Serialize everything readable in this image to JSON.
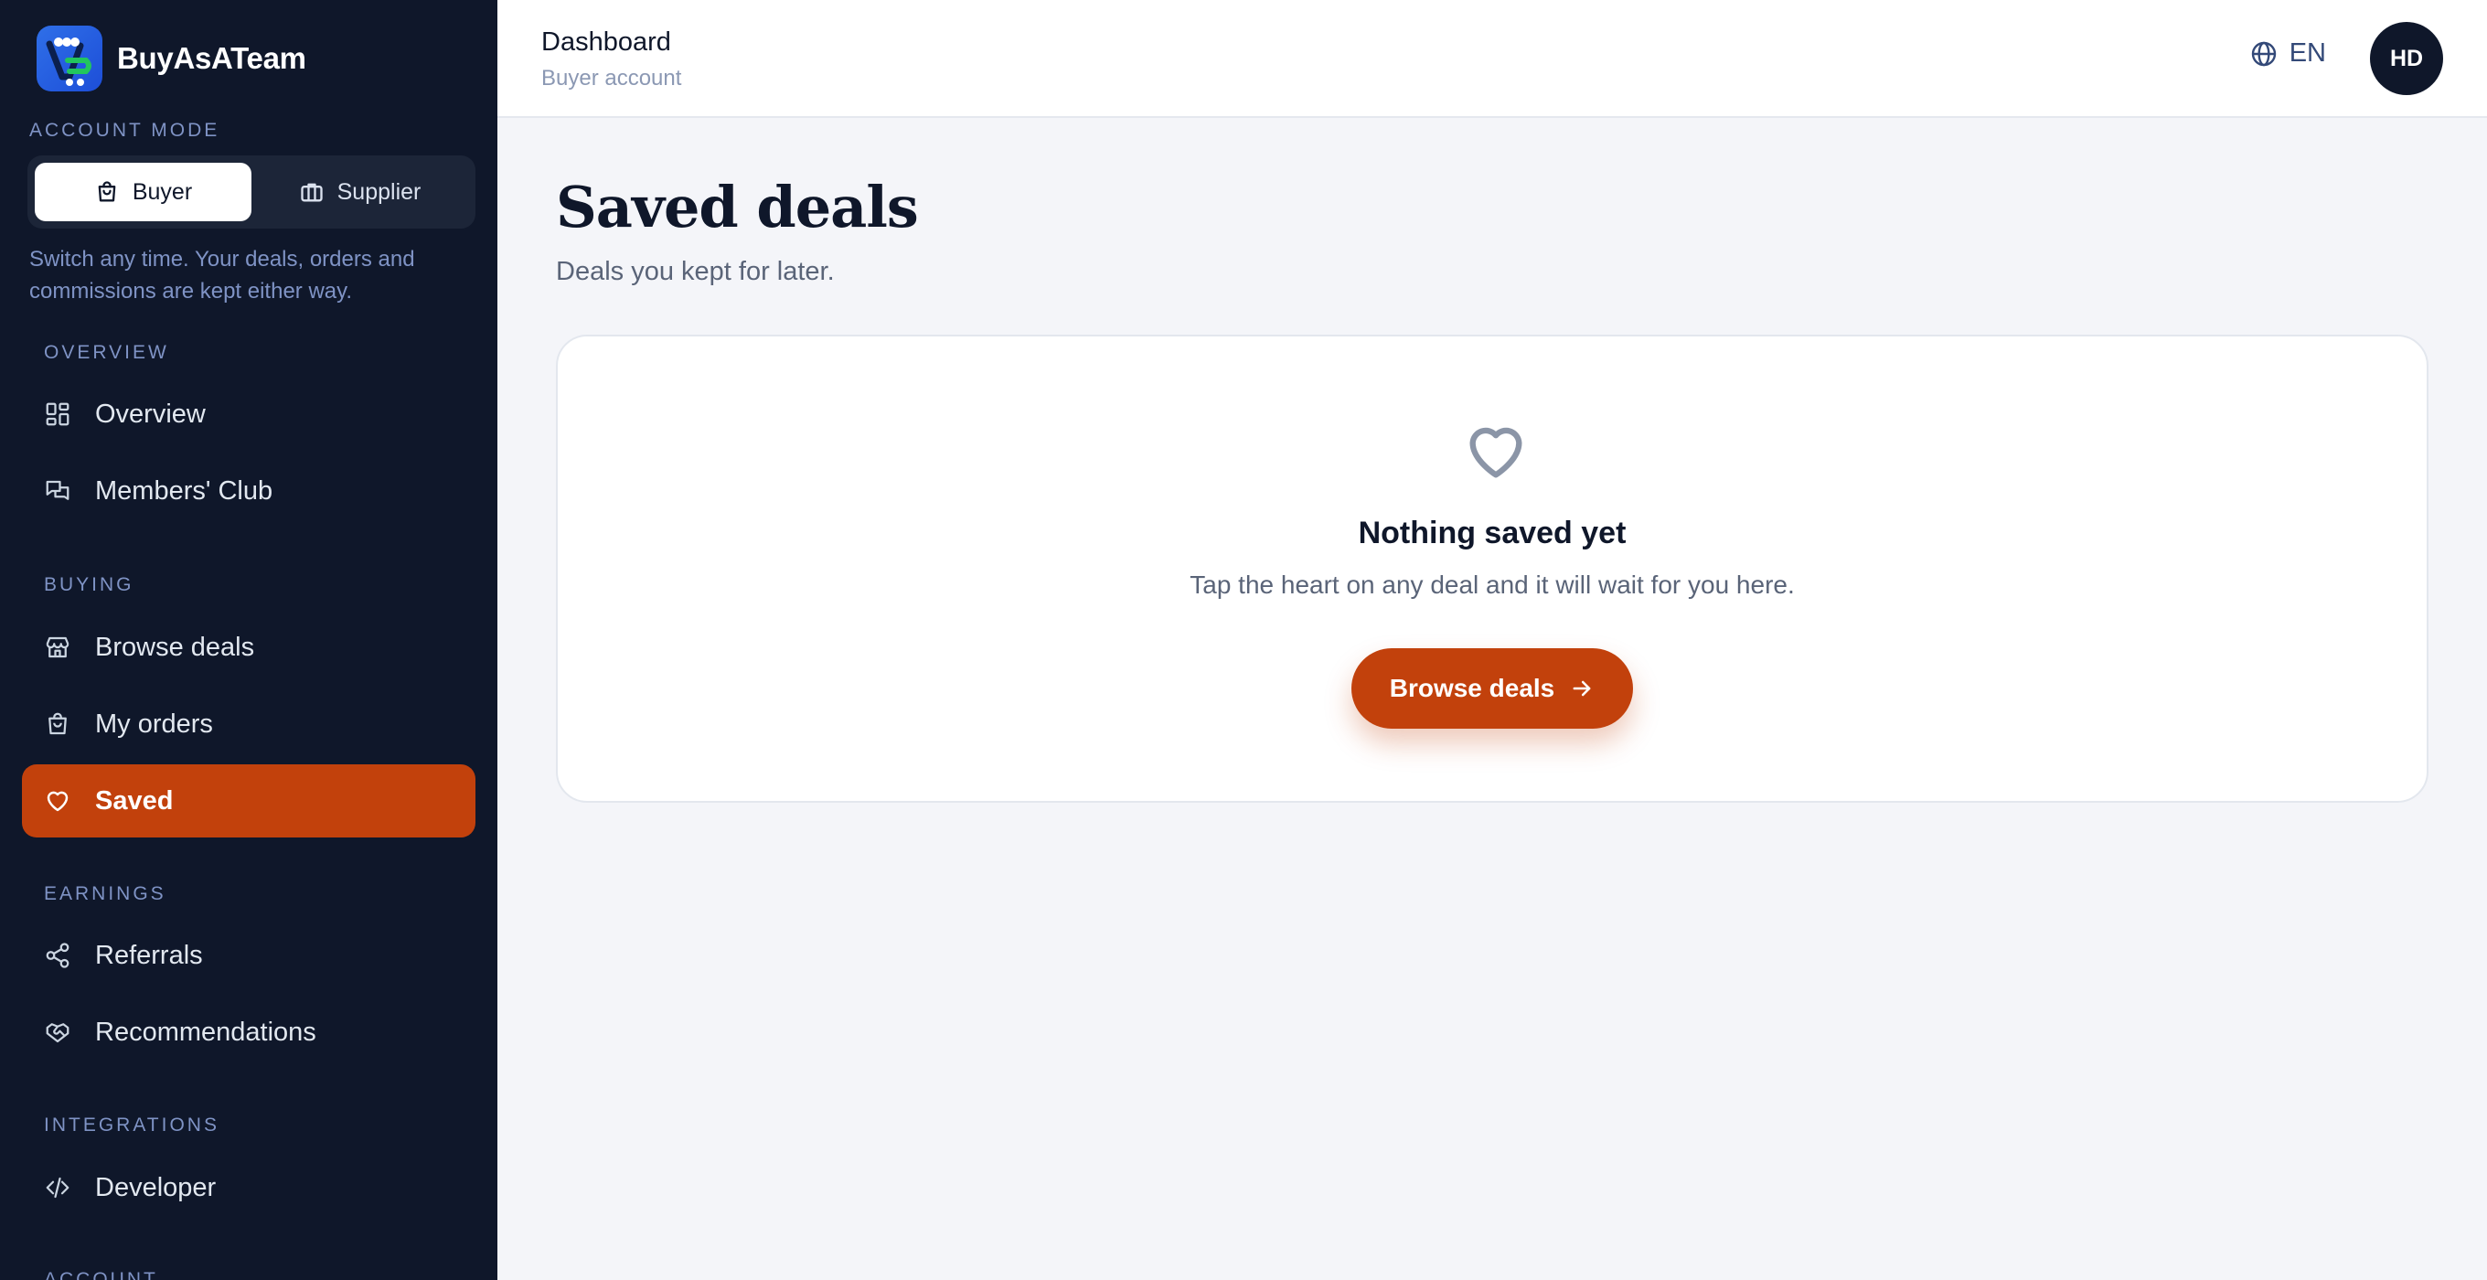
{
  "brand": {
    "name": "BuyAsATeam"
  },
  "account_mode": {
    "label": "ACCOUNT MODE",
    "options": [
      {
        "label": "Buyer",
        "icon": "shopping-bag-icon",
        "active": true
      },
      {
        "label": "Supplier",
        "icon": "briefcase-icon",
        "active": false
      }
    ],
    "hint": "Switch any time. Your deals, orders and commissions are kept either way."
  },
  "nav": {
    "sections": {
      "overview": "OVERVIEW",
      "buying": "BUYING",
      "earnings": "EARNINGS",
      "integrations": "INTEGRATIONS",
      "account": "ACCOUNT"
    },
    "items": {
      "overview": {
        "label": "Overview",
        "icon": "grid-icon"
      },
      "members_club": {
        "label": "Members' Club",
        "icon": "chat-icon"
      },
      "browse_deals": {
        "label": "Browse deals",
        "icon": "store-icon"
      },
      "my_orders": {
        "label": "My orders",
        "icon": "shopping-bag-icon"
      },
      "saved": {
        "label": "Saved",
        "icon": "heart-icon",
        "active": true
      },
      "referrals": {
        "label": "Referrals",
        "icon": "share-icon"
      },
      "recommendations": {
        "label": "Recommendations",
        "icon": "handshake-icon"
      },
      "developer": {
        "label": "Developer",
        "icon": "code-icon"
      }
    }
  },
  "header": {
    "title": "Dashboard",
    "subtitle": "Buyer account",
    "language": "EN",
    "avatar_initials": "HD"
  },
  "main": {
    "title": "Saved deals",
    "subtitle": "Deals you kept for later.",
    "empty_state": {
      "icon": "heart-icon",
      "title": "Nothing saved yet",
      "text": "Tap the heart on any deal and it will wait for you here.",
      "cta_label": "Browse deals"
    }
  },
  "colors": {
    "sidebar_bg": "#0f172a",
    "accent": "#c2410c",
    "page_bg": "#f4f5f9",
    "muted_label": "#7f93c5"
  }
}
